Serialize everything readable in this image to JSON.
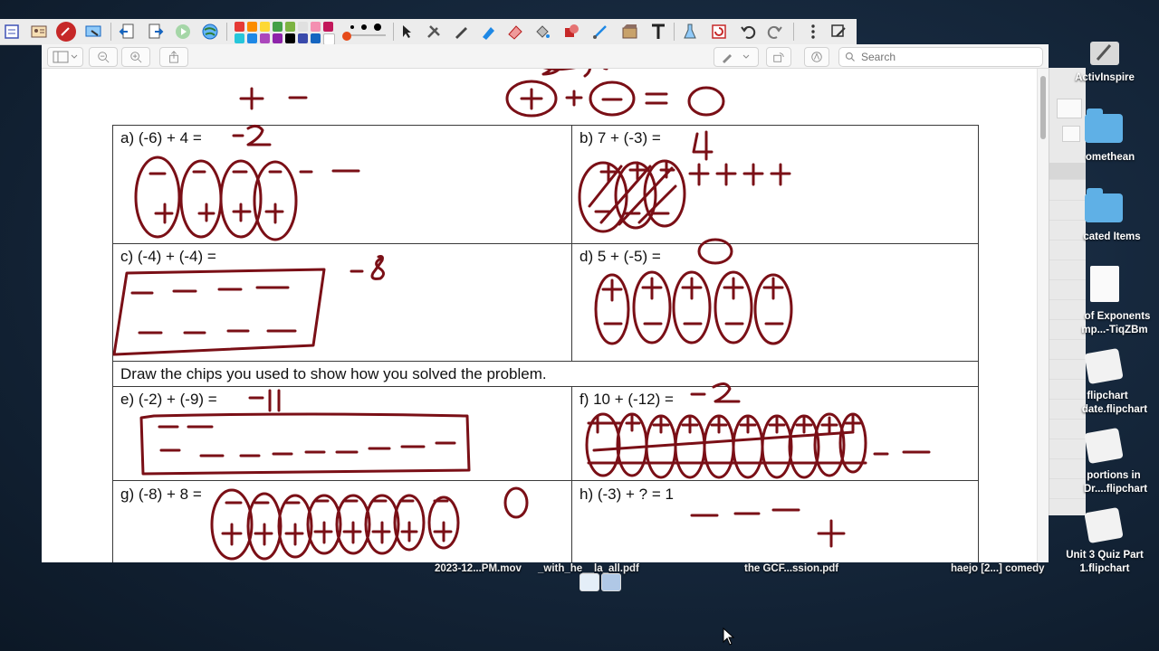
{
  "toolbar": {
    "colors": [
      "#e53935",
      "#fb8c00",
      "#fdd835",
      "#43a047",
      "#7cb342",
      "#e0e0e0",
      "#f48fb1",
      "#c2185b",
      "#26c6da",
      "#1e88e5",
      "#ab47bc",
      "#8e24aa",
      "#000000",
      "#3949ab",
      "#1565c0",
      "#ffffff"
    ],
    "icons": [
      "flipchart-icon",
      "presenter-icon",
      "pen-red-icon",
      "desktop-annotate-icon",
      "page-back-icon",
      "page-forward-icon",
      "play-icon",
      "globe-icon",
      "select-arrow-icon",
      "tools-icon",
      "pen-icon",
      "highlighter-icon",
      "eraser-icon",
      "fill-icon",
      "shape-icon",
      "connector-icon",
      "marquee-icon",
      "text-icon",
      "lab-icon",
      "reset-icon",
      "undo-icon",
      "redo-icon",
      "more-icon",
      "desktop-tools-icon"
    ]
  },
  "docbar": {
    "search_placeholder": "Search"
  },
  "worksheet": {
    "problems": {
      "a": "a) (-6) + 4 =",
      "b": "b) 7 + (-3) =",
      "c": "c) (-4) + (-4) =",
      "d": "d) 5 + (-5) =",
      "e": "e) (-2) + (-9) =",
      "f": "f) 10 + (-12) =",
      "g": "g) (-8) + 8 =",
      "h": "h) (-3) + ? = 1"
    },
    "instruction": "Draw the chips you used to show how you solved the problem."
  },
  "desktop": {
    "items": [
      {
        "label": "ActivInspire",
        "kind": "app"
      },
      {
        "label": "omethean",
        "kind": "folder"
      },
      {
        "label": "cated Items",
        "kind": "folder"
      },
      {
        "label": "of Exponents",
        "label2": "mp...-TiqZBm",
        "kind": "doc"
      },
      {
        "label": "flipchart",
        "label2": "date.flipchart",
        "kind": "flipchart"
      },
      {
        "label": "portions in",
        "label2": "Dr....flipchart",
        "kind": "flipchart"
      },
      {
        "label": "Unit 3 Quiz Part",
        "label2": "1.flipchart",
        "kind": "flipchart"
      }
    ],
    "bottom_files": [
      "2023-12...PM.mov",
      "_with_he__la_all.pdf",
      "the GCF...ssion.pdf",
      "haejo [2...] comedy"
    ]
  }
}
